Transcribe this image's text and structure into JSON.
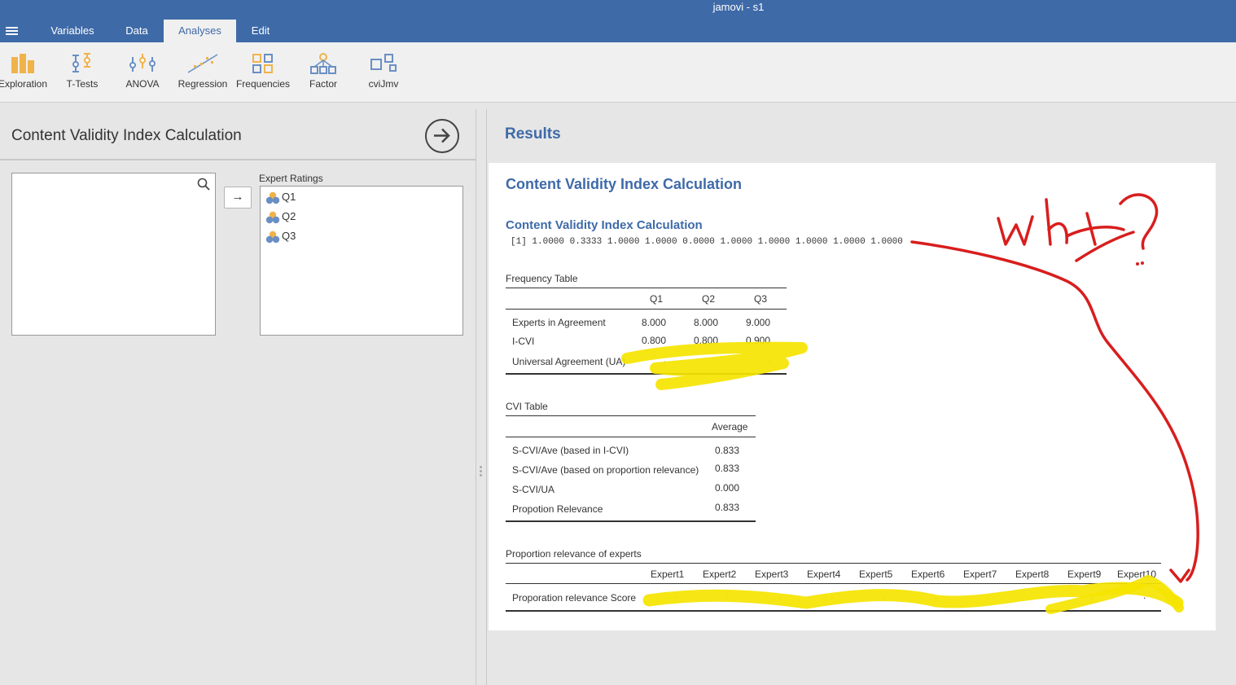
{
  "app": {
    "title": "jamovi - s1"
  },
  "menu": {
    "tabs": [
      "Variables",
      "Data",
      "Analyses",
      "Edit"
    ]
  },
  "ribbon": {
    "items": [
      "Exploration",
      "T-Tests",
      "ANOVA",
      "Regression",
      "Frequencies",
      "Factor",
      "cviJmv"
    ]
  },
  "left_panel": {
    "title": "Content Validity Index Calculation",
    "target_label": "Expert Ratings",
    "variables": [
      "Q1",
      "Q2",
      "Q3"
    ]
  },
  "results": {
    "heading": "Results",
    "analysis_title": "Content Validity Index Calculation",
    "subtitle": "Content Validity Index Calculation",
    "raw_output": "[1] 1.0000 0.3333 1.0000 1.0000 0.0000 1.0000 1.0000 1.0000 1.0000 1.0000",
    "frequency_table": {
      "title": "Frequency Table",
      "columns": [
        "Q1",
        "Q2",
        "Q3"
      ],
      "rows": [
        {
          "label": "Experts in Agreement",
          "values": [
            "8.000",
            "8.000",
            "9.000"
          ]
        },
        {
          "label": "I-CVI",
          "values": [
            "0.800",
            "0.800",
            "0.900"
          ]
        },
        {
          "label": "Universal Agreement (UA)",
          "values": [
            ".",
            ".",
            "."
          ]
        }
      ]
    },
    "cvi_table": {
      "title": "CVI Table",
      "column": "Average",
      "rows": [
        {
          "label": "S-CVI/Ave (based in I-CVI)",
          "value": "0.833"
        },
        {
          "label": "S-CVI/Ave (based on proportion relevance)",
          "value": "0.833"
        },
        {
          "label": "S-CVI/UA",
          "value": "0.000"
        },
        {
          "label": "Propotion Relevance",
          "value": "0.833"
        }
      ]
    },
    "relevance_table": {
      "title": "Proportion relevance of experts",
      "columns": [
        "Expert1",
        "Expert2",
        "Expert3",
        "Expert4",
        "Expert5",
        "Expert6",
        "Expert7",
        "Expert8",
        "Expert9",
        "Expert10"
      ],
      "row_label": "Proporation relevance Score",
      "values": [
        ".",
        ".",
        ".",
        ".",
        ".",
        ".",
        ".",
        ".",
        ".",
        "."
      ]
    }
  },
  "annotation": {
    "text": "why?",
    "highlight_color": "#f5e400",
    "pen_color": "#d81e1e"
  }
}
